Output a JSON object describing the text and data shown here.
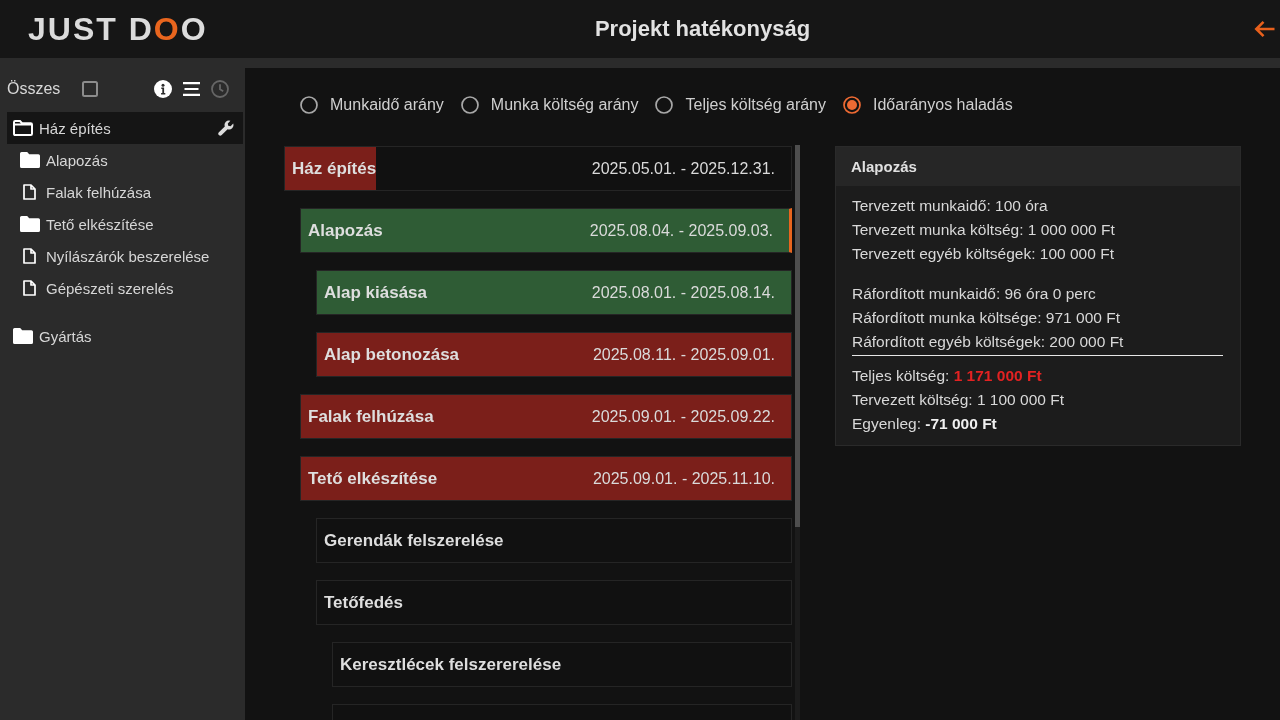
{
  "header": {
    "logo": [
      {
        "text": "JUST D",
        "accent": false
      },
      {
        "text": "O",
        "accent": true
      },
      {
        "text": "O",
        "accent": false
      }
    ],
    "title": "Projekt hatékonyság"
  },
  "sidebar": {
    "select_all": {
      "label": "Összes",
      "checked": false
    },
    "tools": [
      {
        "kind": "info",
        "disabled": false
      },
      {
        "kind": "list",
        "disabled": false
      },
      {
        "kind": "history",
        "disabled": true
      }
    ],
    "items": [
      {
        "label": "Ház építés",
        "kind": "folder",
        "expanded": true,
        "selected": true,
        "children": [
          {
            "label": "Alapozás",
            "kind": "folder",
            "expanded": false,
            "selected": false
          },
          {
            "label": "Falak felhúzása",
            "kind": "file",
            "selected": false
          },
          {
            "label": "Tető elkészítése",
            "kind": "folder",
            "expanded": false,
            "selected": false
          },
          {
            "label": "Nyílászárók beszerelése",
            "kind": "file",
            "selected": false
          },
          {
            "label": "Gépészeti szerelés",
            "kind": "file",
            "selected": false
          }
        ]
      },
      {
        "label": "Gyártás",
        "kind": "folder",
        "expanded": false,
        "selected": false
      }
    ]
  },
  "view_options": [
    {
      "label": "Munkaidő arány",
      "selected": false
    },
    {
      "label": "Munka költség arány",
      "selected": false
    },
    {
      "label": "Teljes költség arány",
      "selected": false
    },
    {
      "label": "Időarányos haladás",
      "selected": true
    }
  ],
  "project_list": {
    "tasks": [
      {
        "title": "Ház építés",
        "dates": "2025.05.01. - 2025.12.31.",
        "color": "#7b1f1a",
        "level": 0.18,
        "selected": false,
        "children": [
          {
            "title": "Alapozás",
            "dates": "2025.08.04. - 2025.09.03.",
            "color": "#2f5c35",
            "level": 1,
            "selected": true,
            "children": [
              {
                "title": "Alap kiásása",
                "dates": "2025.08.01. - 2025.08.14.",
                "color": "#2f5c35",
                "level": 1,
                "selected": false
              },
              {
                "title": "Alap betonozása",
                "dates": "2025.08.11. - 2025.09.01.",
                "color": "#7b1f1a",
                "level": 1,
                "selected": false
              }
            ]
          },
          {
            "title": "Falak felhúzása",
            "dates": "2025.09.01. - 2025.09.22.",
            "color": "#7b1f1a",
            "level": 1,
            "selected": false
          },
          {
            "title": "Tető elkészítése",
            "dates": "2025.09.01. - 2025.11.10.",
            "color": "#7b1f1a",
            "level": 1,
            "selected": false,
            "children": [
              {
                "title": "Gerendák felszerelése",
                "selected": false
              },
              {
                "title": "Tetőfedés",
                "selected": false,
                "children": [
                  {
                    "title": "Keresztlécek felszererelése",
                    "selected": false
                  },
                  {
                    "selected": false
                  }
                ]
              }
            ]
          }
        ]
      }
    ]
  },
  "details": {
    "title": "Alapozás",
    "groups": [
      {
        "kind": "plain",
        "lines": [
          {
            "text": "Tervezett munkaidő: 100 óra"
          },
          {
            "text": "Tervezett munka költség: 1 000 000 Ft"
          },
          {
            "text": "Tervezett egyéb költségek: 100 000 Ft"
          }
        ]
      },
      {
        "kind": "plain",
        "lines": [
          {
            "text": "Ráfordított munkaidő: 96 óra 0 perc"
          },
          {
            "text": "Ráfordított munka költsége: 971 000 Ft"
          },
          {
            "text": "Ráfordított egyéb költségek: 200 000 Ft"
          }
        ]
      },
      {
        "kind": "total",
        "lines": [
          {
            "text": "Teljes költség: **1 171 000 Ft**",
            "alert": true
          },
          {
            "text": "Tervezett költség: 1 100 000 Ft",
            "alert": false
          },
          {
            "text": "Egyenleg: **-71 000 Ft**",
            "alert": false
          }
        ]
      }
    ]
  }
}
